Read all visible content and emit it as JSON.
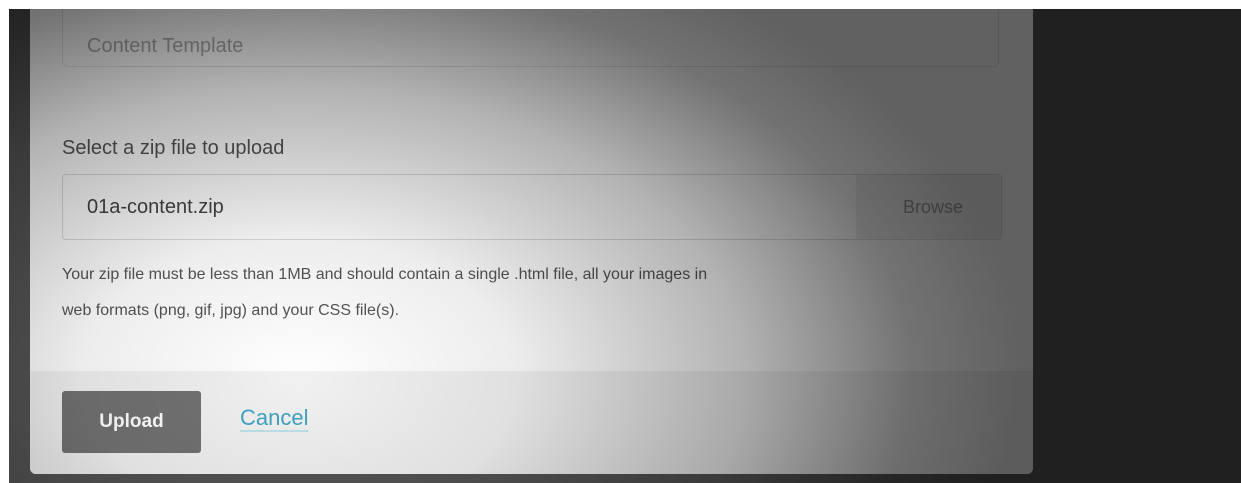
{
  "form": {
    "name_placeholder": "Content Template",
    "upload_label": "Select a zip file to upload",
    "file_value": "01a-content.zip",
    "browse_label": "Browse",
    "help_line1": "Your zip file must be less than 1MB and should contain a single .html file, all your images in",
    "help_line2": "web formats (png, gif, jpg) and your CSS file(s)."
  },
  "footer": {
    "upload_label": "Upload",
    "cancel_label": "Cancel"
  },
  "colors": {
    "backdrop": "#535353",
    "primary_button": "#727272",
    "link": "#3fa3c2",
    "footer_bg": "#f1f1f1"
  }
}
